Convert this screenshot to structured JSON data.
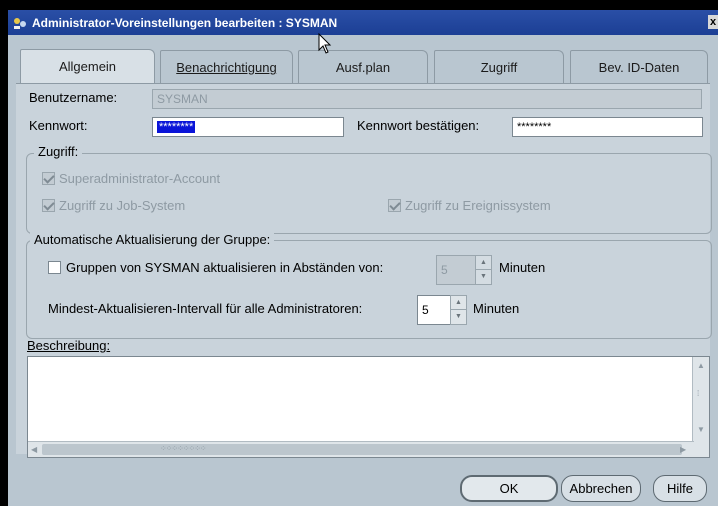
{
  "window": {
    "title": "Administrator-Voreinstellungen bearbeiten : SYSMAN",
    "close_label": "x"
  },
  "tabs": [
    {
      "label": "Allgemein",
      "active": true
    },
    {
      "label": "Benachrichtigung"
    },
    {
      "label": "Ausf.plan"
    },
    {
      "label": "Zugriff"
    },
    {
      "label": "Bev. ID-Daten"
    }
  ],
  "form": {
    "username_label": "Benutzername:",
    "username_value": "SYSMAN",
    "password_label": "Kennwort:",
    "password_value": "********",
    "confirm_label": "Kennwort bestätigen:",
    "confirm_value": "********"
  },
  "access": {
    "title": "Zugriff:",
    "superadmin": "Superadministrator-Account",
    "job_system": "Zugriff zu Job-System",
    "event_system": "Zugriff zu Ereignissystem"
  },
  "auto_update": {
    "title": "Automatische Aktualisierung der Gruppe:",
    "groups_label": "Gruppen von SYSMAN aktualisieren in Abständen von:",
    "groups_value": "5",
    "groups_unit": "Minuten",
    "min_label": "Mindest-Aktualisieren-Intervall für alle Administratoren:",
    "min_value": "5",
    "min_unit": "Minuten"
  },
  "description": {
    "label": "Beschreibung:"
  },
  "buttons": {
    "ok": "OK",
    "cancel": "Abbrechen",
    "help": "Hilfe"
  },
  "colors": {
    "titlebar": "#1c3f95",
    "panel": "#c9d3db",
    "selection": "#0a14d8"
  }
}
